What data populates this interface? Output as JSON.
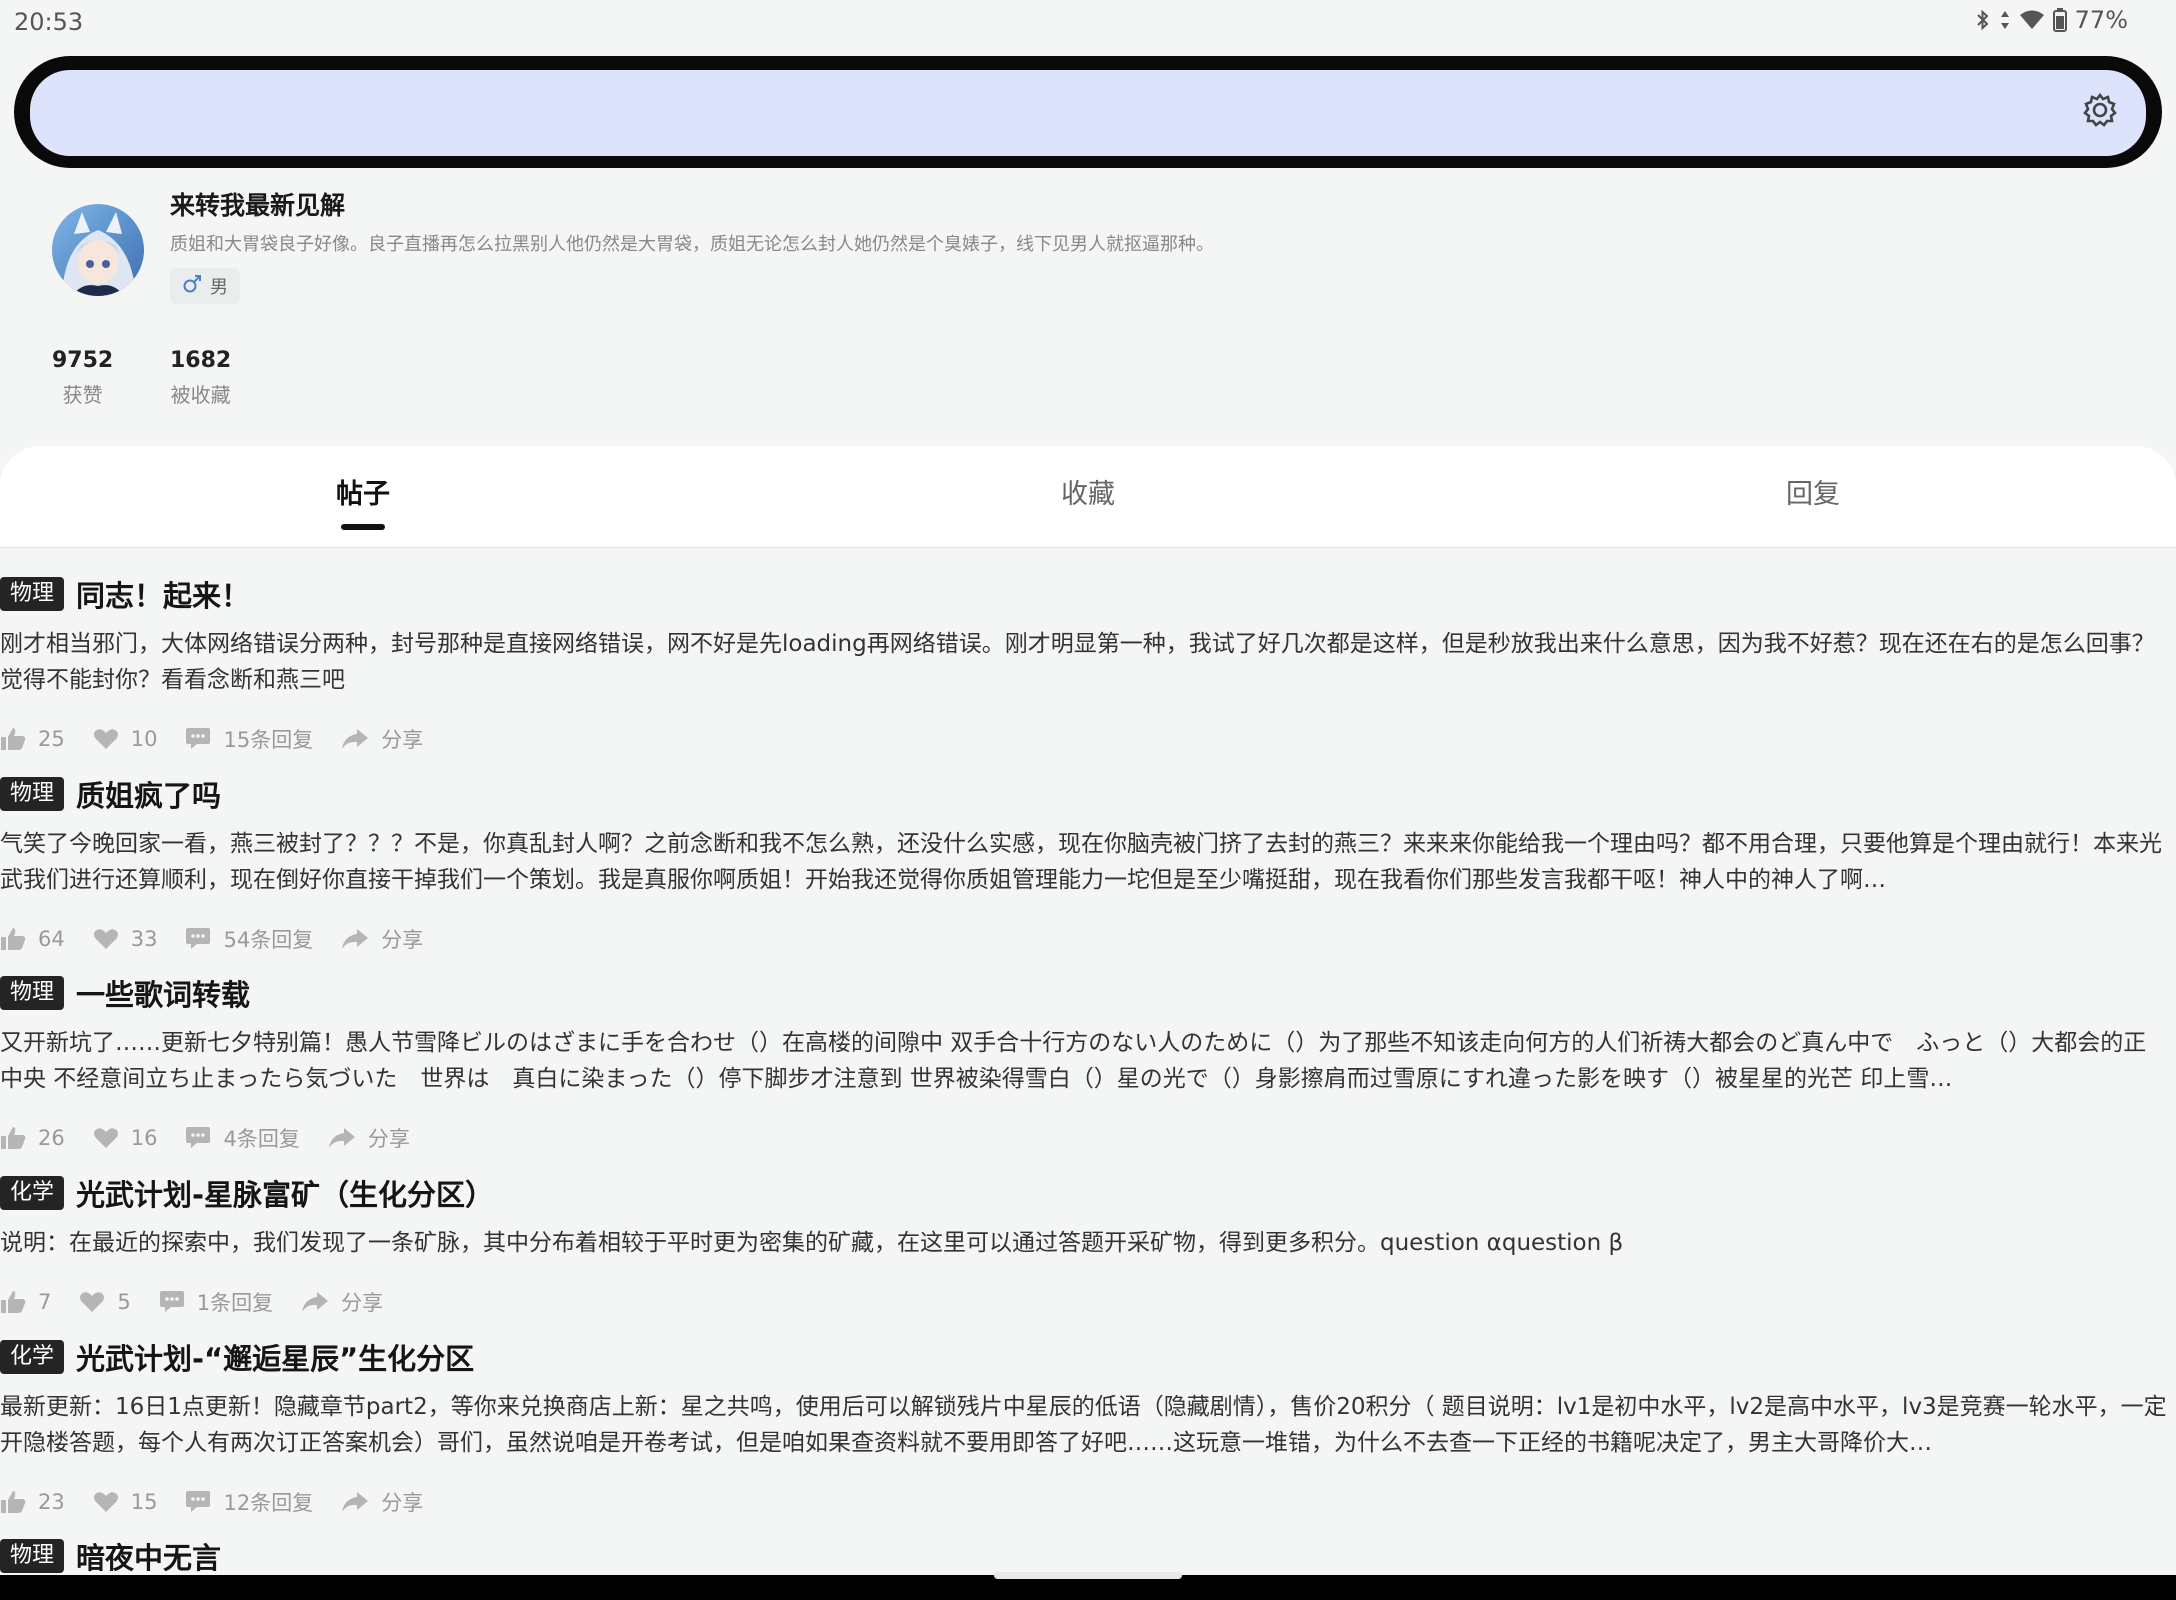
{
  "status_bar": {
    "time": "20:53",
    "battery": "77%"
  },
  "profile": {
    "username": "来转我最新见解",
    "bio": "质姐和大胃袋良子好像。良子直播再怎么拉黑别人他仍然是大胃袋，质姐无论怎么封人她仍然是个臭婊子，线下见男人就抠逼那种。",
    "gender": "男",
    "stats": [
      {
        "value": "9752",
        "label": "获赞"
      },
      {
        "value": "1682",
        "label": "被收藏"
      }
    ]
  },
  "tabs": [
    {
      "label": "帖子",
      "active": true
    },
    {
      "label": "收藏",
      "active": false
    },
    {
      "label": "回复",
      "active": false
    }
  ],
  "posts": [
    {
      "tag": "物理",
      "title": "同志！起来！",
      "body": "刚才相当邪门，大体网络错误分两种，封号那种是直接网络错误，网不好是先loading再网络错误。刚才明显第一种，我试了好几次都是这样，但是秒放我出来什么意思，因为我不好惹？现在还在右的是怎么回事？觉得不能封你？看看念断和燕三吧",
      "likes": "25",
      "favorites": "10",
      "replies": "15条回复",
      "share": "分享"
    },
    {
      "tag": "物理",
      "title": "质姐疯了吗",
      "body": "气笑了今晚回家一看，燕三被封了？？？不是，你真乱封人啊？之前念断和我不怎么熟，还没什么实感，现在你脑壳被门挤了去封的燕三？来来来你能给我一个理由吗？都不用合理，只要他算是个理由就行！本来光武我们进行还算顺利，现在倒好你直接干掉我们一个策划。我是真服你啊质姐！开始我还觉得你质姐管理能力一坨但是至少嘴挺甜，现在我看你们那些发言我都干呕！神人中的神人了啊…",
      "likes": "64",
      "favorites": "33",
      "replies": "54条回复",
      "share": "分享"
    },
    {
      "tag": "物理",
      "title": "一些歌词转载",
      "body": "又开新坑了……更新七夕特别篇！愚人节雪降ビルのはざまに手を合わせ（）在高楼的间隙中 双手合十行方のない人のために（）为了那些不知该走向何方的人们祈祷大都会のど真ん中で　ふっと（）大都会的正中央 不经意间立ち止まったら気づいた　世界は　真白に染まった（）停下脚步才注意到 世界被染得雪白（）星の光で（）身影擦肩而过雪原にすれ違った影を映す（）被星星的光芒 印上雪…",
      "likes": "26",
      "favorites": "16",
      "replies": "4条回复",
      "share": "分享"
    },
    {
      "tag": "化学",
      "title": "光武计划-星脉富矿（生化分区）",
      "body": "说明：在最近的探索中，我们发现了一条矿脉，其中分布着相较于平时更为密集的矿藏，在这里可以通过答题开采矿物，得到更多积分。question αquestion β",
      "likes": "7",
      "favorites": "5",
      "replies": "1条回复",
      "share": "分享"
    },
    {
      "tag": "化学",
      "title": "光武计划-“邂逅星辰”生化分区",
      "body": "最新更新：16日1点更新！隐藏章节part2，等你来兑换商店上新：星之共鸣，使用后可以解锁残片中星辰的低语（隐藏剧情），售价20积分（ 题目说明：lv1是初中水平，lv2是高中水平，lv3是竞赛一轮水平，一定开隐楼答题，每个人有两次订正答案机会）哥们，虽然说咱是开卷考试，但是咱如果查资料就不要用即答了好吧……这玩意一堆错，为什么不去查一下正经的书籍呢决定了，男主大哥降价大…",
      "likes": "23",
      "favorites": "15",
      "replies": "12条回复",
      "share": "分享"
    },
    {
      "tag": "物理",
      "title": "暗夜中无言",
      "body": "",
      "likes": "",
      "favorites": "",
      "replies": "",
      "share": ""
    }
  ]
}
